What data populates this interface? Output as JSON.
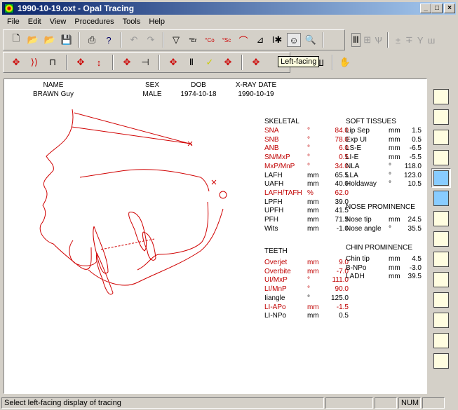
{
  "window": {
    "title": "1990-10-19.oxt - Opal Tracing"
  },
  "menu": [
    "File",
    "Edit",
    "View",
    "Procedures",
    "Tools",
    "Help"
  ],
  "tooltip": "Left-facing",
  "patient": {
    "headers": [
      "NAME",
      "SEX",
      "DOB",
      "X-RAY DATE"
    ],
    "values": [
      "BRAWN Guy",
      "MALE",
      "1974-10-18",
      "1990-10-19"
    ]
  },
  "skeletal": {
    "title": "SKELETAL",
    "rows": [
      {
        "label": "SNA",
        "unit": "°",
        "value": "84.0",
        "flag": true
      },
      {
        "label": "SNB",
        "unit": "°",
        "value": "78.0",
        "flag": true
      },
      {
        "label": "ANB",
        "unit": "°",
        "value": "6.0",
        "flag": true
      },
      {
        "label": "SN/MxP",
        "unit": "°",
        "value": "0.5",
        "flag": true
      },
      {
        "label": "MxP/MnP",
        "unit": "°",
        "value": "34.0",
        "flag": true
      },
      {
        "label": "LAFH",
        "unit": "mm",
        "value": "65.5",
        "flag": false
      },
      {
        "label": "UAFH",
        "unit": "mm",
        "value": "40.0",
        "flag": false
      },
      {
        "label": "LAFH/TAFH",
        "unit": "%",
        "value": "62.0",
        "flag": true
      },
      {
        "label": "LPFH",
        "unit": "mm",
        "value": "39.0",
        "flag": false
      },
      {
        "label": "UPFH",
        "unit": "mm",
        "value": "41.5",
        "flag": false
      },
      {
        "label": "PFH",
        "unit": "mm",
        "value": "71.5",
        "flag": false
      },
      {
        "label": "Wits",
        "unit": "mm",
        "value": "-1.0",
        "flag": false
      }
    ]
  },
  "teeth": {
    "title": "TEETH",
    "rows": [
      {
        "label": "Overjet",
        "unit": "mm",
        "value": "9.0",
        "flag": true
      },
      {
        "label": "Overbite",
        "unit": "mm",
        "value": "-7.0",
        "flag": true
      },
      {
        "label": "UI/MxP",
        "unit": "°",
        "value": "111.0",
        "flag": true
      },
      {
        "label": "LI/MnP",
        "unit": "°",
        "value": "90.0",
        "flag": true
      },
      {
        "label": "Iiangle",
        "unit": "°",
        "value": "125.0",
        "flag": false
      },
      {
        "label": "LI-APo",
        "unit": "mm",
        "value": "-1.5",
        "flag": true
      },
      {
        "label": "LI-NPo",
        "unit": "mm",
        "value": "0.5",
        "flag": false
      }
    ]
  },
  "soft": {
    "title": "SOFT TISSUES",
    "rows": [
      {
        "label": "Lip Sep",
        "unit": "mm",
        "value": "1.5"
      },
      {
        "label": "Exp UI",
        "unit": "mm",
        "value": "0.5"
      },
      {
        "label": "LS-E",
        "unit": "mm",
        "value": "-6.5"
      },
      {
        "label": "LI-E",
        "unit": "mm",
        "value": "-5.5"
      },
      {
        "label": "NLA",
        "unit": "°",
        "value": "118.0"
      },
      {
        "label": "LLA",
        "unit": "°",
        "value": "123.0"
      },
      {
        "label": "Holdaway",
        "unit": "°",
        "value": "10.5"
      }
    ]
  },
  "nose": {
    "title": "NOSE PROMINENCE",
    "rows": [
      {
        "label": "Nose tip",
        "unit": "mm",
        "value": "24.5"
      },
      {
        "label": "Nose angle",
        "unit": "°",
        "value": "35.5"
      }
    ]
  },
  "chin": {
    "title": "CHIN PROMINENCE",
    "rows": [
      {
        "label": "Chin tip",
        "unit": "mm",
        "value": "4.5"
      },
      {
        "label": "B-NPo",
        "unit": "mm",
        "value": "-3.0"
      },
      {
        "label": "LADH",
        "unit": "mm",
        "value": "39.5"
      }
    ]
  },
  "status": {
    "text": "Select left-facing display of tracing",
    "num": "NUM"
  },
  "colors": {
    "flag": "#c00000",
    "tracing": "#d00000"
  }
}
